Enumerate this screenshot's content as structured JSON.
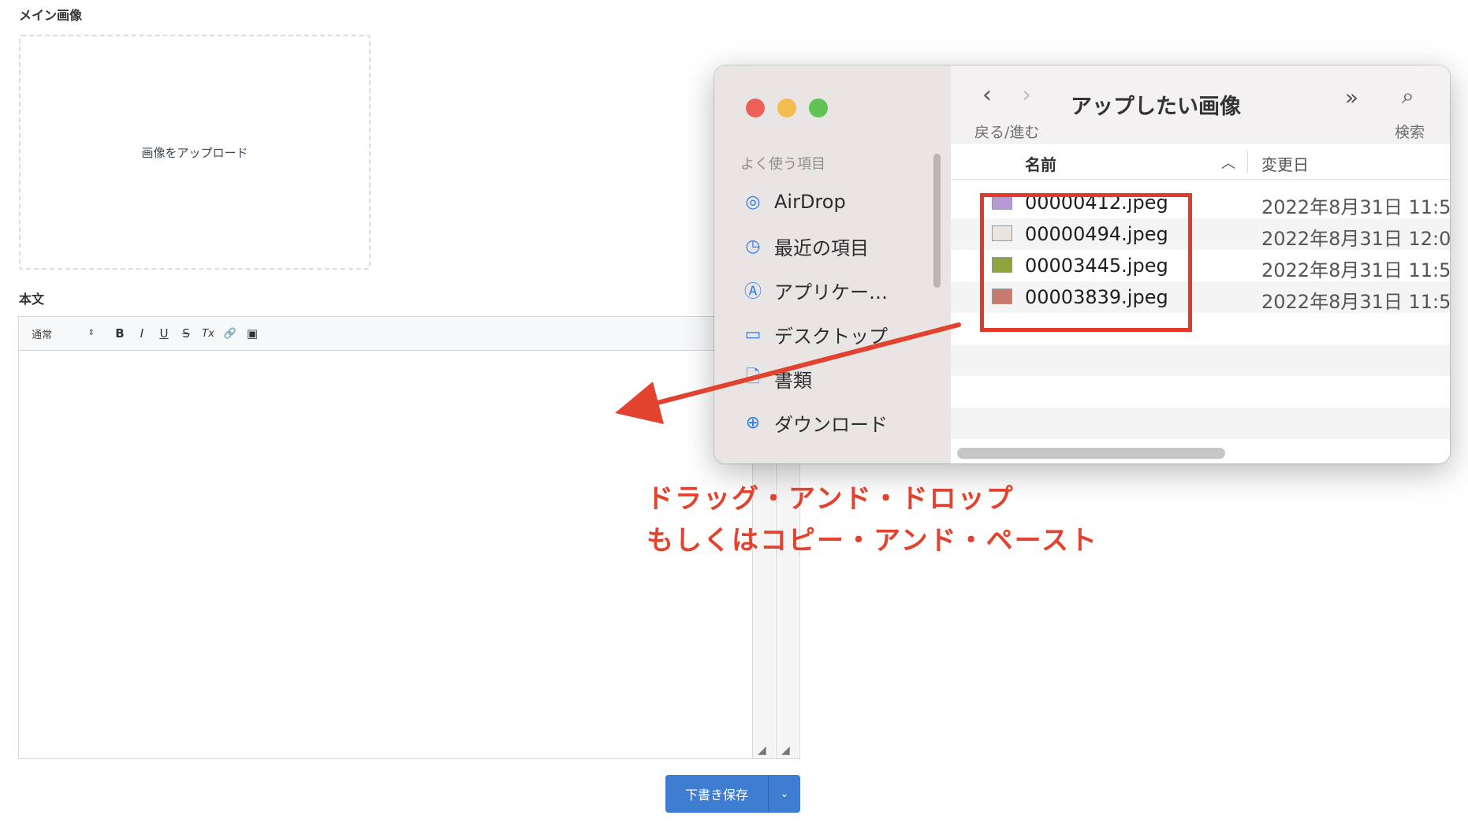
{
  "form": {
    "main_image_label": "メイン画像",
    "upload_text": "画像をアップロード",
    "body_label": "本文",
    "toolbar": {
      "paragraph_select": "通常",
      "bold": "B",
      "italic": "I",
      "underline": "U",
      "strike": "S",
      "clear_format": "Tx",
      "link": "🔗",
      "image": "▣"
    },
    "save_button": "下書き保存",
    "save_dropdown": "⌄"
  },
  "finder": {
    "sidebar_heading": "よく使う項目",
    "sidebar_items": [
      {
        "label": "AirDrop",
        "icon": "airdrop-icon",
        "glyph": "◎"
      },
      {
        "label": "最近の項目",
        "icon": "clock-icon",
        "glyph": "◷"
      },
      {
        "label": "アプリケー…",
        "icon": "applications-icon",
        "glyph": "Ⓐ"
      },
      {
        "label": "デスクトップ",
        "icon": "desktop-icon",
        "glyph": "▭"
      },
      {
        "label": "書類",
        "icon": "document-icon",
        "glyph": "🗋"
      },
      {
        "label": "ダウンロード",
        "icon": "download-icon",
        "glyph": "⊕"
      }
    ],
    "nav_label": "戻る/進む",
    "title": "アップしたい画像",
    "search_label": "検索",
    "columns": {
      "name": "名前",
      "date": "変更日"
    },
    "files": [
      {
        "name": "00000412.jpeg",
        "date": "2022年8月31日 11:5",
        "thumb_color": "#b59ad6"
      },
      {
        "name": "00000494.jpeg",
        "date": "2022年8月31日 12:0",
        "thumb_color": "#e9e4dd"
      },
      {
        "name": "00003445.jpeg",
        "date": "2022年8月31日 11:5",
        "thumb_color": "#8fa33f"
      },
      {
        "name": "00003839.jpeg",
        "date": "2022年8月31日 11:5",
        "thumb_color": "#c77a6d"
      }
    ]
  },
  "annotation": {
    "line1": "ドラッグ・アンド・ドロップ",
    "line2": "もしくはコピー・アンド・ペースト",
    "color": "#e1432e"
  }
}
